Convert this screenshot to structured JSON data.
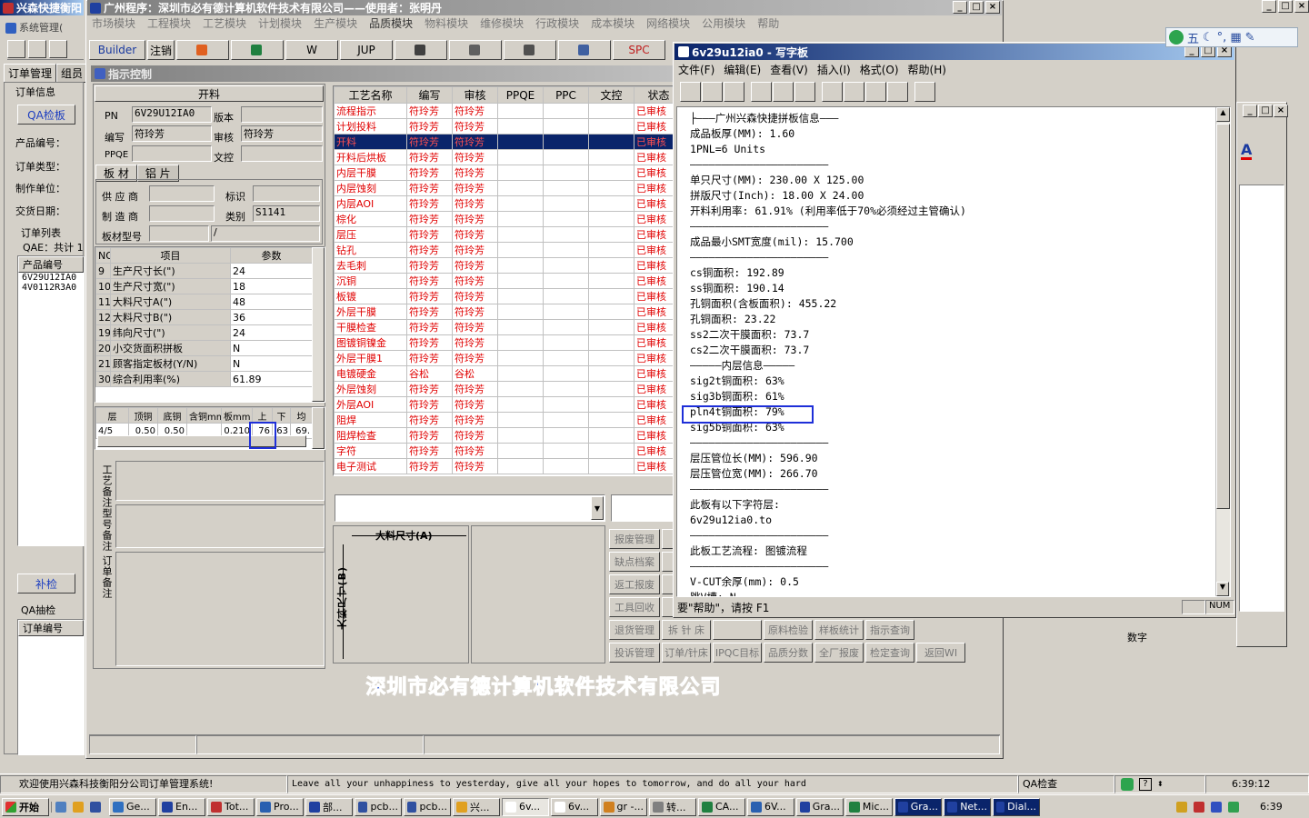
{
  "outer": {
    "title": "兴森快捷衡阳",
    "system_menu": "系统管理(",
    "tabs": [
      "订单管理",
      "组员"
    ],
    "order_info": "订单信息",
    "qa_btn": "QA检板",
    "fields": [
      "产品编号：",
      "订单类型：",
      "制作单位：",
      "交货日期："
    ],
    "order_list": "订单列表",
    "qae": "QAE：共计 1",
    "col": "产品编号",
    "rows": [
      "6V29U12IA0",
      "4V0112R3A0"
    ],
    "recheck": "补检",
    "qa_sample": "QA抽检",
    "col2": "订单编号"
  },
  "main": {
    "title": "广州程序：深圳市必有德计算机软件技术有限公司——使用者：张明丹",
    "menu": [
      "市场模块",
      "工程模块",
      "工艺模块",
      "计划模块",
      "生产模块",
      "品质模块",
      "物料模块",
      "维修模块",
      "行政模块",
      "成本模块",
      "网络模块",
      "公用模块",
      "帮助"
    ],
    "toolbar": [
      "Builder",
      "注销",
      "",
      "",
      "W",
      "JUP",
      "",
      "",
      "",
      "",
      "SPC"
    ],
    "company": "深圳市必有德计算机软件技术有限公司"
  },
  "ctrl": {
    "title": "指示控制",
    "section": "开料",
    "pn_l": "PN",
    "pn": "6V29U12IA0",
    "ver_l": "版本",
    "writer_l": "编写",
    "writer": "符玲芳",
    "review_l": "审核",
    "reviewer": "符玲芳",
    "ppqe_l": "PPQE",
    "doc_l": "文控",
    "tabs": [
      "板 材",
      "铝 片"
    ],
    "supplier_l": "供 应 商",
    "mark_l": "标识",
    "maker_l": "制 造 商",
    "type_l": "类别",
    "type": "S1141",
    "model_l": "板材型号",
    "model2": "/",
    "param_head": [
      "NO",
      "项目",
      "参数"
    ],
    "params": [
      [
        "9",
        "生产尺寸长(\")",
        "24"
      ],
      [
        "10",
        "生产尺寸宽(\")",
        "18"
      ],
      [
        "11",
        "大料尺寸A(\")",
        "48"
      ],
      [
        "12",
        "大料尺寸B(\")",
        "36"
      ],
      [
        "19",
        "纬向尺寸(\")",
        "24"
      ],
      [
        "20",
        "小交货面积拼板",
        "N"
      ],
      [
        "21",
        "顾客指定板材(Y/N)",
        "N"
      ],
      [
        "30",
        "综合利用率(%)",
        "61.89"
      ]
    ],
    "layer_head": [
      "层",
      "顶铜",
      "底铜",
      "含铜mm",
      "板mm",
      "上",
      "下",
      "均"
    ],
    "layer_row": [
      "4/5",
      "0.50",
      "0.50",
      "",
      "0.210",
      "76",
      "63",
      "69."
    ],
    "notes": [
      "工艺备注",
      "型号备注",
      "订单备注"
    ]
  },
  "process": {
    "head": [
      "工艺名称",
      "编写",
      "审核",
      "PPQE",
      "PPC",
      "文控",
      "状态"
    ],
    "status": "已审核",
    "rows": [
      [
        "流程指示",
        "符玲芳",
        "符玲芳"
      ],
      [
        "计划投料",
        "符玲芳",
        "符玲芳"
      ],
      [
        "开料",
        "符玲芳",
        "符玲芳"
      ],
      [
        "开料后烘板",
        "符玲芳",
        "符玲芳"
      ],
      [
        "内层干膜",
        "符玲芳",
        "符玲芳"
      ],
      [
        "内层蚀刻",
        "符玲芳",
        "符玲芳"
      ],
      [
        "内层AOI",
        "符玲芳",
        "符玲芳"
      ],
      [
        "棕化",
        "符玲芳",
        "符玲芳"
      ],
      [
        "层压",
        "符玲芳",
        "符玲芳"
      ],
      [
        "钻孔",
        "符玲芳",
        "符玲芳"
      ],
      [
        "去毛刺",
        "符玲芳",
        "符玲芳"
      ],
      [
        "沉铜",
        "符玲芳",
        "符玲芳"
      ],
      [
        "板镀",
        "符玲芳",
        "符玲芳"
      ],
      [
        "外层干膜",
        "符玲芳",
        "符玲芳"
      ],
      [
        "干膜检查",
        "符玲芳",
        "符玲芳"
      ],
      [
        "图镀铜镍金",
        "符玲芳",
        "符玲芳"
      ],
      [
        "外层干膜1",
        "符玲芳",
        "符玲芳"
      ],
      [
        "电镀硬金",
        "谷松",
        "谷松"
      ],
      [
        "外层蚀刻",
        "符玲芳",
        "符玲芳"
      ],
      [
        "外层AOI",
        "符玲芳",
        "符玲芳"
      ],
      [
        "阻焊",
        "符玲芳",
        "符玲芳"
      ],
      [
        "阻焊检查",
        "符玲芳",
        "符玲芳"
      ],
      [
        "字符",
        "符玲芳",
        "符玲芳"
      ],
      [
        "电子测试",
        "符玲芳",
        "符玲芳"
      ]
    ],
    "dim_a": "大料尺寸(A)",
    "dim_b": "大料尺寸(B)",
    "buttons": [
      [
        "报废管理",
        "计"
      ],
      [
        "缺点档案",
        "检"
      ],
      [
        "返工报废",
        "计"
      ],
      [
        "工具回收",
        "针"
      ],
      [
        "退货管理",
        "拆 针 床",
        "",
        "原料检验",
        "样板统计",
        "指示查询"
      ],
      [
        "投诉管理",
        "订单/针床",
        "IPQC目标",
        "品质分数",
        "全厂报废",
        "检定查询",
        "返回WI"
      ]
    ]
  },
  "wordpad": {
    "title": "6v29u12ia0 - 写字板",
    "menu": [
      "文件(F)",
      "编辑(E)",
      "查看(V)",
      "插入(I)",
      "格式(O)",
      "帮助(H)"
    ],
    "lines": [
      "├———广州兴森快捷拼板信息———",
      "成品板厚(MM): 1.60",
      "1PNL=6 Units",
      "——————————————————————",
      "单只尺寸(MM): 230.00 X 125.00",
      "拼版尺寸(Inch): 18.00 X 24.00",
      "开料利用率: 61.91% (利用率低于70%必须经过主管确认)",
      "——————————————————————",
      "成品最小SMT宽度(mil): 15.700",
      "——————————————————————",
      "cs铜面积: 192.89",
      "ss铜面积: 190.14",
      "孔铜面积(含板面积): 455.22",
      "孔铜面积: 23.22",
      "ss2二次干膜面积: 73.7",
      "cs2二次干膜面积: 73.7",
      "—————内层信息—————",
      "sig2t铜面积: 63%",
      "sig3b铜面积: 61%",
      "pln4t铜面积: 79%",
      "sig5b铜面积: 63%",
      "——————————————————————",
      "层压管位长(MM): 596.90",
      "层压管位宽(MM): 266.70",
      "——————————————————————",
      "此板有以下字符层:",
      "6v29u12ia0.to",
      "——————————————————————",
      "此板工艺流程: 图镀流程",
      "——————————————————————",
      "V-CUT余厚(mm): 0.5",
      "跳V槽: N"
    ],
    "status": "要\"帮助\"，请按 F1",
    "num": "NUM"
  },
  "right": {
    "ime": "五",
    "digit": "数字"
  },
  "status": {
    "welcome": "欢迎使用兴森科技衡阳分公司订单管理系统!",
    "motto": "Leave all your unhappiness to yesterday, give all your hopes to tomorrow, and do all your hard",
    "qa": "QA检查",
    "time": "6:39:12"
  },
  "taskbar": {
    "start": "开始",
    "items": [
      "Ge...",
      "En...",
      "Tot...",
      "Pro...",
      "部...",
      "pcb...",
      "pcb...",
      "兴...",
      "6v...",
      "6v...",
      "gr -...",
      "转...",
      "CA...",
      "6V...",
      "Gra...",
      "Mic...",
      "Gra...",
      "Net...",
      "Dial..."
    ],
    "clock": "6:39"
  },
  "colors": {
    "title_active": "#0a246a",
    "grid_red": "#e00000",
    "selection": "#0a246a",
    "highlight_box": "#1e2fd8",
    "company_blue": "#3b5fd0"
  }
}
